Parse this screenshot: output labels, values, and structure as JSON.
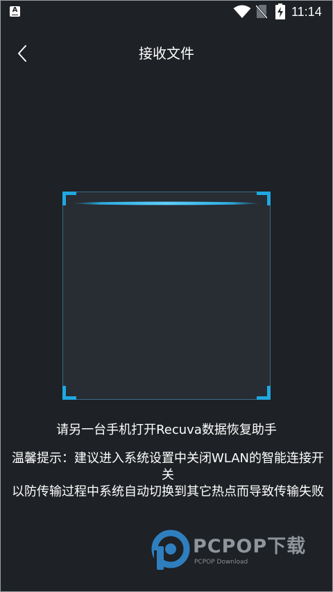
{
  "status_bar": {
    "app_icon_letter": "A",
    "time": "11:14",
    "icons": [
      "app-notification-icon",
      "wifi-icon",
      "no-sim-icon",
      "battery-charging-icon"
    ]
  },
  "header": {
    "back_icon": "chevron-left-icon",
    "title": "接收文件"
  },
  "scan": {
    "frame_color": "#1fa8e0"
  },
  "content": {
    "instruction": "请另一台手机打开Recuva数据恢复助手",
    "tip": "温馨提示：建议进入系统设置中关闭WLAN的智能连接开关\n以防传输过程中系统自动切换到其它热点而导致传输失败"
  },
  "watermark": {
    "brand": "PCPOP下载",
    "sub": "PCPOP Download"
  }
}
